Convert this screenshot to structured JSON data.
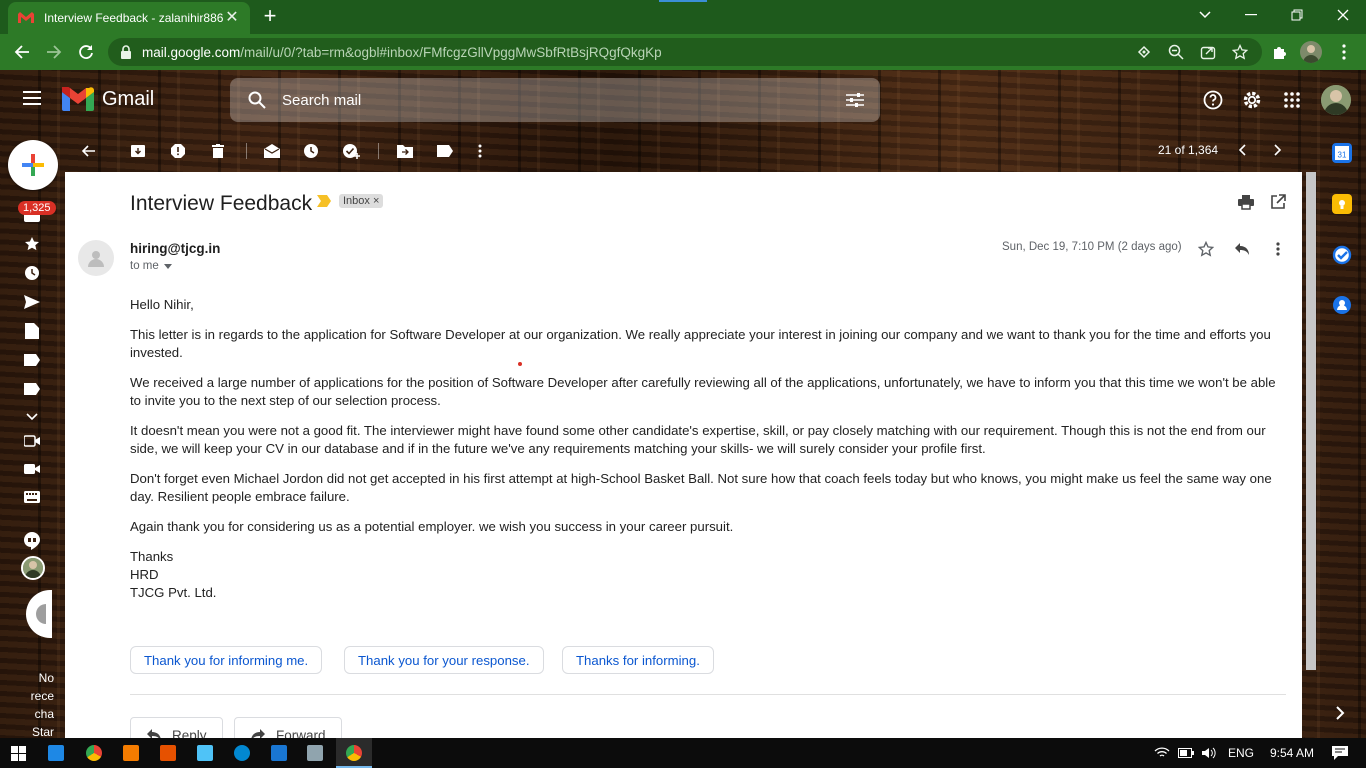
{
  "browser": {
    "tab_title": "Interview Feedback - zalanihir886",
    "url_host": "mail.google.com",
    "url_path": "/mail/u/0/?tab=rm&ogbl#inbox/FMfcgzGllVpggMwSbfRtBsjRQgfQkgKp"
  },
  "gmail": {
    "logo_text": "Gmail",
    "search_placeholder": "Search mail",
    "unread_count": "1,325",
    "pager": "21 of 1,364"
  },
  "email": {
    "subject": "Interview Feedback",
    "label": "Inbox",
    "sender": "hiring@tjcg.in",
    "to": "to me",
    "date": "Sun, Dec 19, 7:10 PM (2 days ago)",
    "body": [
      "Hello Nihir,",
      "This letter is in regards to the application for Software Developer at our organization. We really appreciate your interest in joining our company and we want to thank you for the time and efforts you invested.",
      "We received a large number of applications for the position of Software Developer after carefully reviewing all of the applications, unfortunately, we have to inform you that this time we won't be able to invite you to the next step of our selection process.",
      "It doesn't mean you were not a good fit. The interviewer might have found some other candidate's expertise, skill, or pay closely matching with our requirement. Though this is not the end from our side, we will keep your CV in our database and if in the future we've any requirements matching your skills- we will surely consider your profile first.",
      "Don't forget even Michael Jordon did not get accepted in his first attempt at high-School Basket Ball. Not sure how that coach feels today but who knows, you might make us feel the same way one day. Resilient people embrace failure.",
      "Again thank you for considering us as a potential employer. we wish you success in your career pursuit."
    ],
    "signature": [
      "Thanks",
      "HRD",
      "TJCG Pvt. Ltd."
    ],
    "smart_replies": [
      "Thank you for informing me.",
      "Thank you for your response.",
      "Thanks for informing."
    ],
    "reply_label": "Reply",
    "forward_label": "Forward"
  },
  "left_partial_text": [
    "No",
    "rece",
    "cha",
    "Star"
  ],
  "taskbar": {
    "language": "ENG",
    "time": "9:54 AM"
  },
  "colors": {
    "chrome_frame": "#1e5a1c",
    "chrome_toolbar": "#2d7a27",
    "link_blue": "#0b57d0",
    "badge_red": "#d93025"
  }
}
